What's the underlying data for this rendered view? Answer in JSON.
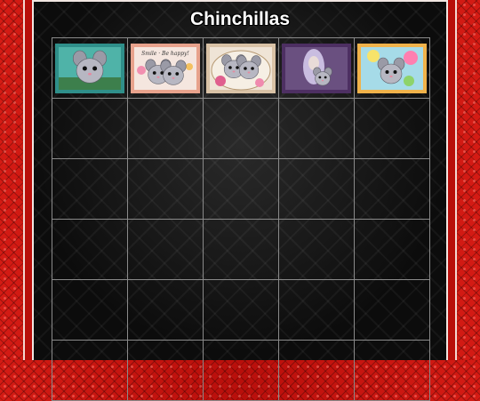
{
  "page": {
    "title": "Chinchillas"
  },
  "thumbnails": [
    {
      "name": "thumb-chinchilla-teal",
      "frame": "#2f8f8a",
      "bg": "#4fb3a8",
      "accent": "#9fd8c8"
    },
    {
      "name": "thumb-chinchillas-smile-be-happy",
      "frame": "#e8a28c",
      "bg": "#f5e6df",
      "accent": "#f28fb0",
      "caption": "Smile · Be happy!"
    },
    {
      "name": "thumb-chinchillas-roses",
      "frame": "#d9c2a6",
      "bg": "#efe4d6",
      "accent": "#e05f8e"
    },
    {
      "name": "thumb-woman-with-chinchilla",
      "frame": "#4d2f62",
      "bg": "#6a5080",
      "accent": "#c9bde0"
    },
    {
      "name": "thumb-chinchilla-rainbow",
      "frame": "#f0b24a",
      "bg": "#a6dbe8",
      "accent": "#ff7fb0"
    }
  ]
}
